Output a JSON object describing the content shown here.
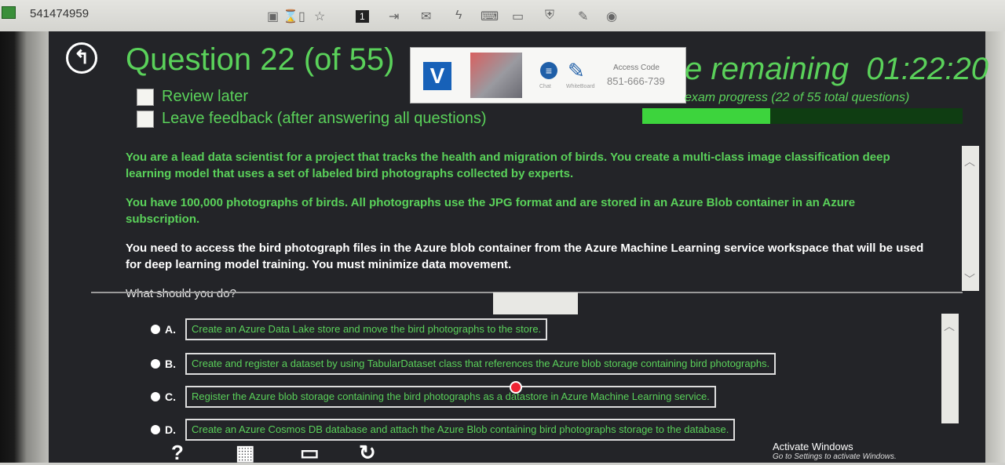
{
  "session": {
    "id": "541474959"
  },
  "toolbar": {
    "page_badge": "1"
  },
  "exam": {
    "question_title": "Question 22 (of 55)",
    "review_later": "Review later",
    "leave_feedback": "Leave feedback (after answering all questions)",
    "time_remaining_label": "e remaining",
    "time_remaining_value": "01:22:20",
    "exam_progress": "exam progress (22 of 55 total questions)",
    "progress_fraction": 0.4,
    "progress_color": "#3dd43d",
    "accent_green": "#5ad15a"
  },
  "remote_overlay": {
    "chat_label": "Chat",
    "whiteboard_label": "WhiteBoard",
    "access_code_label": "Access Code",
    "access_code": "851-666-739"
  },
  "question": {
    "para1": "You are a lead data scientist for a project that tracks the health and migration of birds. You create a multi-class image classification deep learning model that uses a set of labeled bird photographs collected by experts.",
    "para2": "You have 100,000 photographs of birds. All photographs use the JPG format and are stored in an Azure Blob container in an Azure subscription.",
    "para3": "You need to access the bird photograph files in the Azure blob container from the Azure Machine Learning service workspace that will be used for deep learning model training. You must minimize data movement.",
    "prompt": "What should you do?"
  },
  "answers": [
    {
      "letter": "A.",
      "text": "Create an Azure Data Lake store and move the bird photographs to the store."
    },
    {
      "letter": "B.",
      "text": "Create and register a dataset by using TabularDataset class that references the Azure blob storage containing bird photographs."
    },
    {
      "letter": "C.",
      "text": "Register the Azure blob storage containing the bird photographs as a datastore in Azure Machine Learning service."
    },
    {
      "letter": "D.",
      "text": "Create an Azure Cosmos DB database and attach the Azure Blob containing bird photographs storage to the database."
    }
  ],
  "bottom": {
    "help": "?"
  },
  "windows_watermark": {
    "title": "Activate Windows",
    "subtitle": "Go to Settings to activate Windows."
  }
}
